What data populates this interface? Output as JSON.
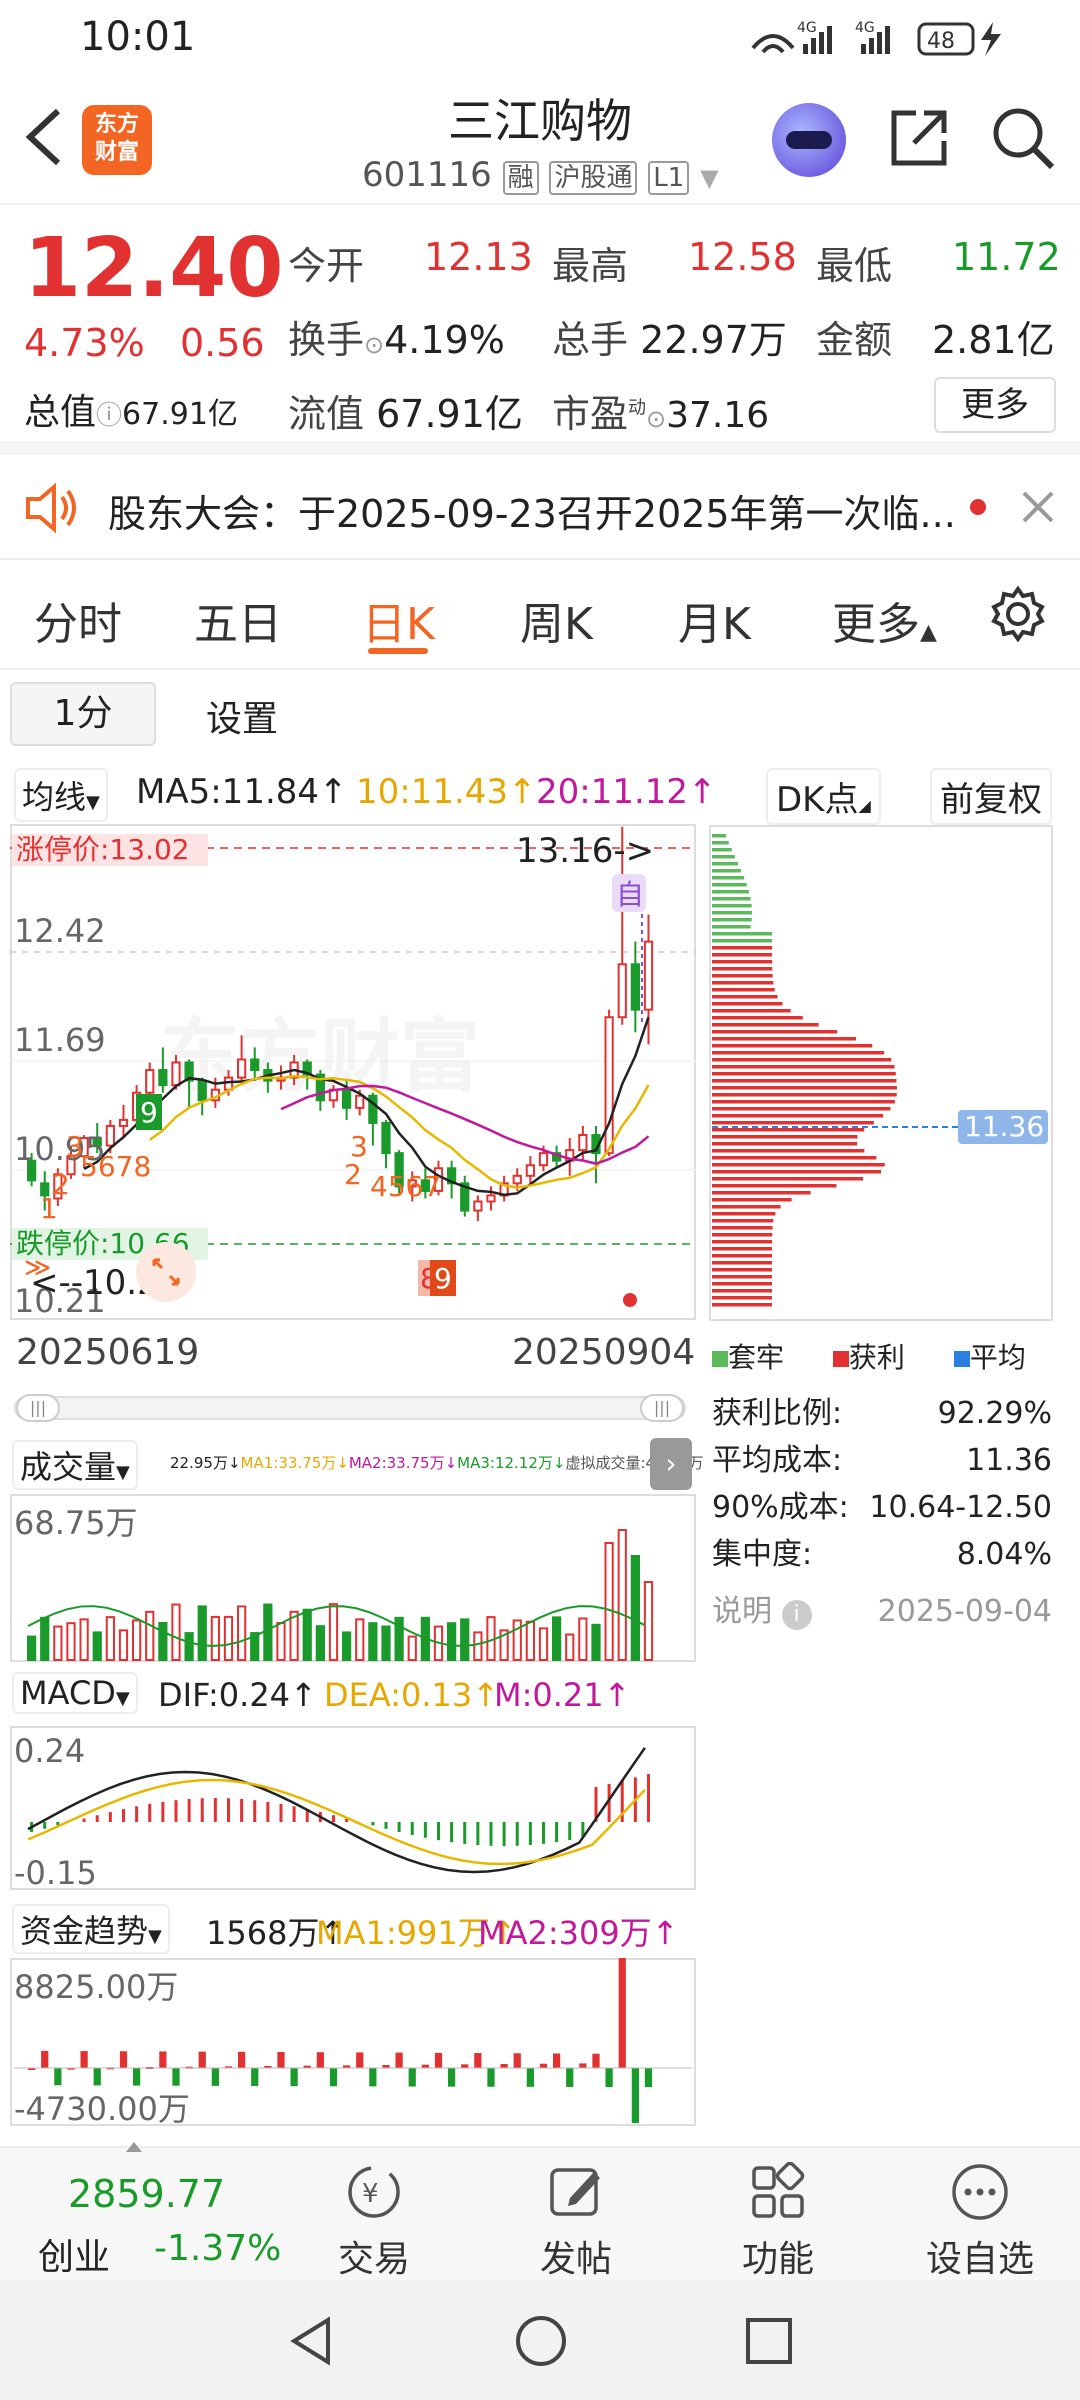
{
  "status": {
    "time": "10:01",
    "battery": "48",
    "net1": "4G",
    "net2": "4G"
  },
  "header": {
    "title": "三江购物",
    "code": "601116",
    "tags": [
      "融",
      "沪股通",
      "L1"
    ],
    "logo": "东方\n财富",
    "icons": [
      "back-icon",
      "share-icon",
      "search-icon"
    ]
  },
  "quote": {
    "price": "12.40",
    "change_pct": "4.73%",
    "change": "0.56",
    "open_label": "今开",
    "open": "12.13",
    "high_label": "最高",
    "high": "12.58",
    "low_label": "最低",
    "low": "11.72",
    "turnover_label": "换手",
    "turnover": "4.19%",
    "volume_label": "总手",
    "volume": "22.97万",
    "amount_label": "金额",
    "amount": "2.81亿",
    "mcap_label": "总值",
    "mcap": "67.91亿",
    "float_label": "流值",
    "float": "67.91亿",
    "pe_label": "市盈",
    "pe_sup": "动",
    "pe": "37.16",
    "more": "更多"
  },
  "notice": {
    "text": "股东大会：于2025-09-23召开2025年第一次临..."
  },
  "tabs": [
    "分时",
    "五日",
    "日K",
    "周K",
    "月K",
    "更多"
  ],
  "active_tab": "日K",
  "subtabs": {
    "period": "1分",
    "settings": "设置"
  },
  "ma_bar": {
    "label": "均线",
    "ma5": "MA5:11.84↑",
    "ma10": "10:11.43↑",
    "ma20": "20:11.12↑",
    "dk": "DK点",
    "fq": "前复权"
  },
  "kline": {
    "limit_up": "涨停价:13.02",
    "limit_down": "跌停价:10.66",
    "high_mark": "13.16->",
    "low_mark": "<--10.21",
    "y_labels": [
      "12.42",
      "11.69",
      "10.95",
      "10.21"
    ],
    "date_start": "20250619",
    "date_end": "20250904",
    "zi": "自",
    "nine_a": "9",
    "nine_b": "8",
    "nine_c": "9",
    "tags1": "3",
    "tags2": "2",
    "tags3": "5678",
    "tags4": "1",
    "tags5": "3",
    "tags6": "2",
    "tags7": "4567",
    "candles": [
      [
        10.95,
        10.82,
        11.0,
        10.78
      ],
      [
        10.8,
        10.72,
        10.88,
        10.62
      ],
      [
        10.7,
        10.86,
        10.9,
        10.65
      ],
      [
        10.86,
        10.98,
        11.05,
        10.83
      ],
      [
        10.98,
        11.1,
        11.12,
        10.9
      ],
      [
        11.1,
        11.05,
        11.2,
        11.0
      ],
      [
        11.05,
        11.18,
        11.22,
        11.0
      ],
      [
        11.18,
        11.22,
        11.32,
        11.1
      ],
      [
        11.22,
        11.4,
        11.45,
        11.18
      ],
      [
        11.4,
        11.55,
        11.6,
        11.35
      ],
      [
        11.55,
        11.45,
        11.7,
        11.4
      ],
      [
        11.45,
        11.6,
        11.65,
        11.42
      ],
      [
        11.6,
        11.48,
        11.62,
        11.3
      ],
      [
        11.48,
        11.35,
        11.5,
        11.25
      ],
      [
        11.35,
        11.42,
        11.5,
        11.3
      ],
      [
        11.42,
        11.5,
        11.55,
        11.38
      ],
      [
        11.5,
        11.62,
        11.78,
        11.45
      ],
      [
        11.62,
        11.55,
        11.7,
        11.48
      ],
      [
        11.55,
        11.48,
        11.6,
        11.4
      ],
      [
        11.48,
        11.5,
        11.58,
        11.42
      ],
      [
        11.5,
        11.6,
        11.65,
        11.45
      ],
      [
        11.6,
        11.52,
        11.62,
        11.42
      ],
      [
        11.52,
        11.35,
        11.55,
        11.28
      ],
      [
        11.35,
        11.42,
        11.45,
        11.3
      ],
      [
        11.42,
        11.3,
        11.48,
        11.22
      ],
      [
        11.3,
        11.38,
        11.42,
        11.25
      ],
      [
        11.38,
        11.2,
        11.4,
        11.05
      ],
      [
        11.2,
        11.0,
        11.22,
        10.9
      ],
      [
        11.0,
        10.78,
        11.02,
        10.72
      ],
      [
        10.78,
        10.82,
        10.88,
        10.68
      ],
      [
        10.82,
        10.75,
        10.9,
        10.7
      ],
      [
        10.75,
        10.9,
        10.95,
        10.72
      ],
      [
        10.9,
        10.8,
        10.95,
        10.7
      ],
      [
        10.8,
        10.62,
        10.85,
        10.58
      ],
      [
        10.62,
        10.68,
        10.72,
        10.55
      ],
      [
        10.68,
        10.72,
        10.78,
        10.62
      ],
      [
        10.72,
        10.8,
        10.85,
        10.68
      ],
      [
        10.8,
        10.85,
        10.9,
        10.75
      ],
      [
        10.85,
        10.92,
        10.98,
        10.8
      ],
      [
        10.92,
        11.0,
        11.05,
        10.88
      ],
      [
        11.0,
        10.95,
        11.05,
        10.9
      ],
      [
        10.95,
        11.02,
        11.1,
        10.85
      ],
      [
        11.02,
        11.12,
        11.18,
        10.95
      ],
      [
        11.12,
        11.0,
        11.18,
        10.8
      ],
      [
        11.0,
        11.9,
        11.95,
        10.98
      ],
      [
        11.9,
        12.25,
        13.16,
        11.85
      ],
      [
        12.25,
        11.95,
        12.4,
        11.8
      ],
      [
        11.95,
        12.4,
        12.58,
        11.72
      ]
    ],
    "chip_avg": "11.36"
  },
  "chip_legend": [
    "套牢",
    "获利",
    "平均"
  ],
  "chip_stats": [
    {
      "label": "获利比例:",
      "value": "92.29%"
    },
    {
      "label": "平均成本:",
      "value": "11.36"
    },
    {
      "label": "90%成本:",
      "value": "10.64-12.50"
    },
    {
      "label": "集中度:",
      "value": "8.04%"
    }
  ],
  "chip_note": {
    "label": "说明",
    "date": "2025-09-04"
  },
  "volume": {
    "label": "成交量",
    "info": "22.95万↓",
    "ma1": "MA1:33.75万↓",
    "ma2": "MA2:33.75万↓",
    "ma3": "MA3:12.12万↓",
    "virt": "虚拟成交量:48.23万",
    "top": "68.75万"
  },
  "macd": {
    "label": "MACD",
    "dif": "DIF:0.24↑",
    "dea": "DEA:0.13↑",
    "m": "M:0.21↑",
    "top": "0.24",
    "bottom": "-0.15"
  },
  "flow": {
    "label": "资金趋势",
    "v": "1568万↑",
    "ma1": "MA1:991万↑",
    "ma2": "MA2:309万↑",
    "top": "8825.00万",
    "bottom": "-4730.00万"
  },
  "bottom_bar": {
    "index_value": "2859.77",
    "index_name": "创业",
    "index_change": "-1.37%",
    "items": [
      "交易",
      "发帖",
      "功能",
      "设自选"
    ]
  },
  "colors": {
    "up": "#e23131",
    "down": "#1a9a2a",
    "accent": "#ff6a00",
    "ma5": "#222222",
    "ma10": "#e6b800",
    "ma20": "#c2189b"
  }
}
